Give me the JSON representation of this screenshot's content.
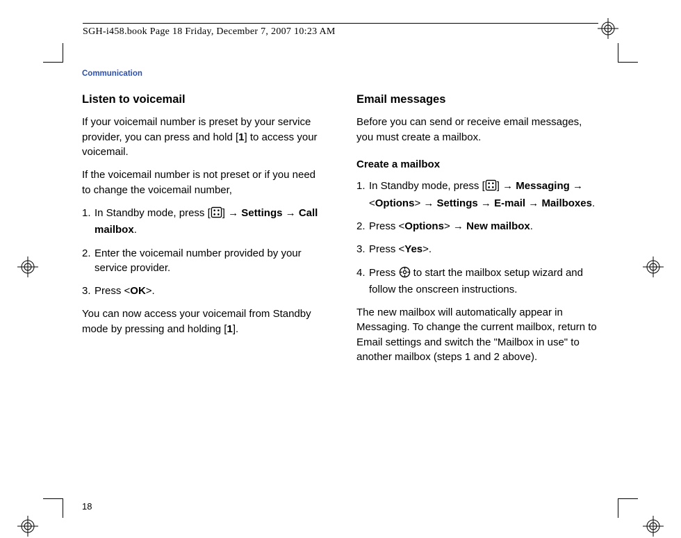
{
  "header": {
    "running_head": "SGH-i458.book  Page 18  Friday, December 7, 2007  10:23 AM"
  },
  "section_label": "Communication",
  "page_number": "18",
  "left": {
    "title": "Listen to voicemail",
    "intro1_a": "If your voicemail number is preset by your service provider, you can press and hold [",
    "intro1_b": "1",
    "intro1_c": "] to access your voicemail.",
    "intro2": "If the voicemail number is not preset or if you need to change the voicemail number,",
    "step1_num": "1.",
    "step1_a": "In Standby mode, press [",
    "step1_b": "] → ",
    "step1_settings": "Settings",
    "step1_arrow": " → ",
    "step1_call_mailbox": "Call mailbox",
    "step1_end": ".",
    "step2_num": "2.",
    "step2": "Enter the voicemail number provided by your service provider.",
    "step3_num": "3.",
    "step3_a": "Press <",
    "step3_ok": "OK",
    "step3_b": ">.",
    "outro_a": "You can now access your voicemail from Standby mode by pressing and holding [",
    "outro_b": "1",
    "outro_c": "]."
  },
  "right": {
    "title": "Email messages",
    "intro": "Before you can send or receive email messages, you must create a mailbox.",
    "sub": "Create a mailbox",
    "s1_num": "1.",
    "s1_a": "In Standby mode, press [",
    "s1_b": "] → ",
    "s1_messaging": "Messaging",
    "s1_arr1": " → <",
    "s1_options": "Options",
    "s1_arr2": "> → ",
    "s1_settings": "Settings",
    "s1_arr3": " → ",
    "s1_email": "E-mail",
    "s1_arr4": " → ",
    "s1_mailboxes": "Mailboxes",
    "s1_end": ".",
    "s2_num": "2.",
    "s2_a": "Press <",
    "s2_options": "Options",
    "s2_b": "> → ",
    "s2_newmailbox": "New mailbox",
    "s2_end": ".",
    "s3_num": "3.",
    "s3_a": "Press <",
    "s3_yes": "Yes",
    "s3_b": ">.",
    "s4_num": "4.",
    "s4_a": "Press ",
    "s4_b": " to start the mailbox setup wizard and follow the onscreen instructions.",
    "outro": "The new mailbox will automatically appear in Messaging. To change the current mailbox, return to Email settings and switch the \"Mailbox in use\" to another mailbox (steps 1 and 2 above)."
  }
}
